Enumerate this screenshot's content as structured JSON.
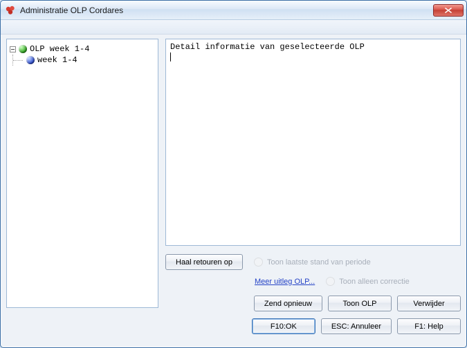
{
  "window": {
    "title": "Administratie OLP Cordares"
  },
  "tree": {
    "root": {
      "label": "OLP week 1-4"
    },
    "child": {
      "label": "week 1-4"
    }
  },
  "detail": {
    "text": "Detail informatie van geselecteerde OLP"
  },
  "mid": {
    "haal_retouren": "Haal retouren op",
    "link": "Meer uitleg OLP...",
    "radio_period": "Toon laatste stand van periode",
    "radio_correction": "Toon alleen correctie"
  },
  "buttons": {
    "zend": "Zend opnieuw",
    "toon": "Toon OLP",
    "verwijder": "Verwijder",
    "ok": "F10:OK",
    "annuleer": "ESC: Annuleer",
    "help": "F1: Help"
  }
}
